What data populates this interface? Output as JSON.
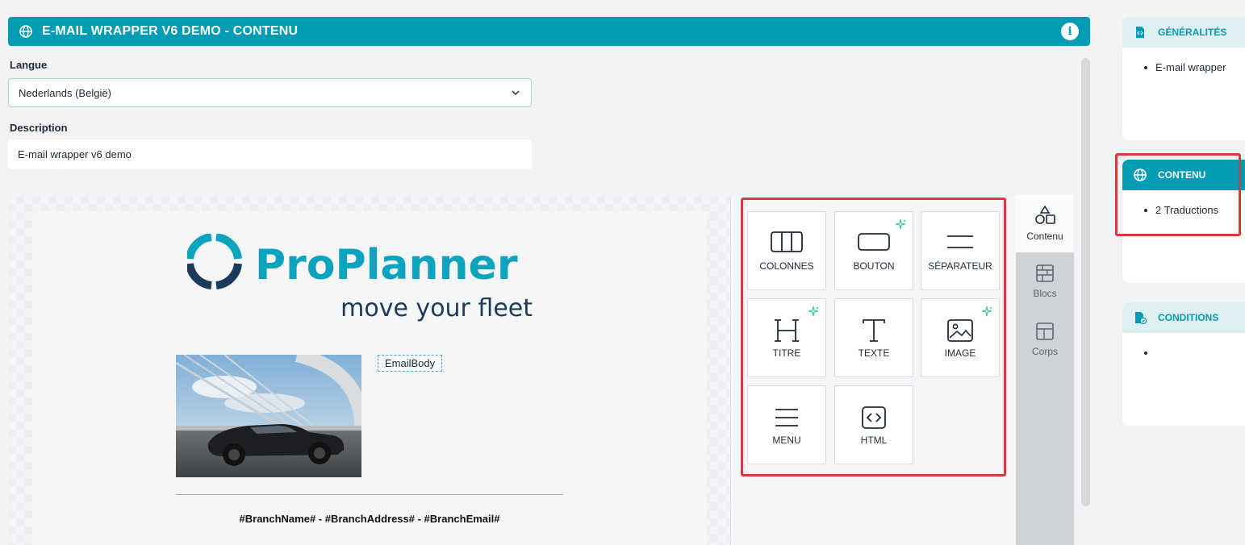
{
  "header": {
    "title": "E-MAIL WRAPPER V6 DEMO - CONTENU",
    "info_icon": "i"
  },
  "form": {
    "language_label": "Langue",
    "language_value": "Nederlands (België)",
    "description_label": "Description",
    "description_value": "E-mail wrapper v6 demo"
  },
  "email": {
    "logo_brand": "ProPlanner",
    "logo_tagline": "move your fleet",
    "body_placeholder": "EmailBody",
    "footer": "#BranchName# - #BranchAddress# - #BranchEmail#"
  },
  "blocks": [
    {
      "label": "COLONNES",
      "icon": "columns-icon",
      "ai": false
    },
    {
      "label": "BOUTON",
      "icon": "button-icon",
      "ai": true
    },
    {
      "label": "SÉPARATEUR",
      "icon": "divider-icon",
      "ai": false
    },
    {
      "label": "TITRE",
      "icon": "heading-icon",
      "ai": true
    },
    {
      "label": "TEXTE",
      "icon": "text-icon",
      "ai": false
    },
    {
      "label": "IMAGE",
      "icon": "image-icon",
      "ai": true
    },
    {
      "label": "MENU",
      "icon": "menu-icon",
      "ai": false
    },
    {
      "label": "HTML",
      "icon": "code-icon",
      "ai": false
    }
  ],
  "side_tabs": [
    {
      "label": "Contenu",
      "icon": "shapes-icon",
      "active": true
    },
    {
      "label": "Blocs",
      "icon": "bricks-icon",
      "active": false
    },
    {
      "label": "Corps",
      "icon": "layout-icon",
      "active": false
    }
  ],
  "sidebar": {
    "generalites": {
      "title": "GÉNÉRALITÉS",
      "items": [
        "E-mail wrapper"
      ]
    },
    "contenu": {
      "title": "CONTENU",
      "items": [
        "2 Traductions"
      ]
    },
    "conditions": {
      "title": "CONDITIONS",
      "items": [
        ""
      ]
    }
  },
  "colors": {
    "accent": "#009cb5",
    "navy": "#1b3a5c",
    "highlight": "#d93b3b",
    "ai_spark": "#2bbf9b"
  }
}
